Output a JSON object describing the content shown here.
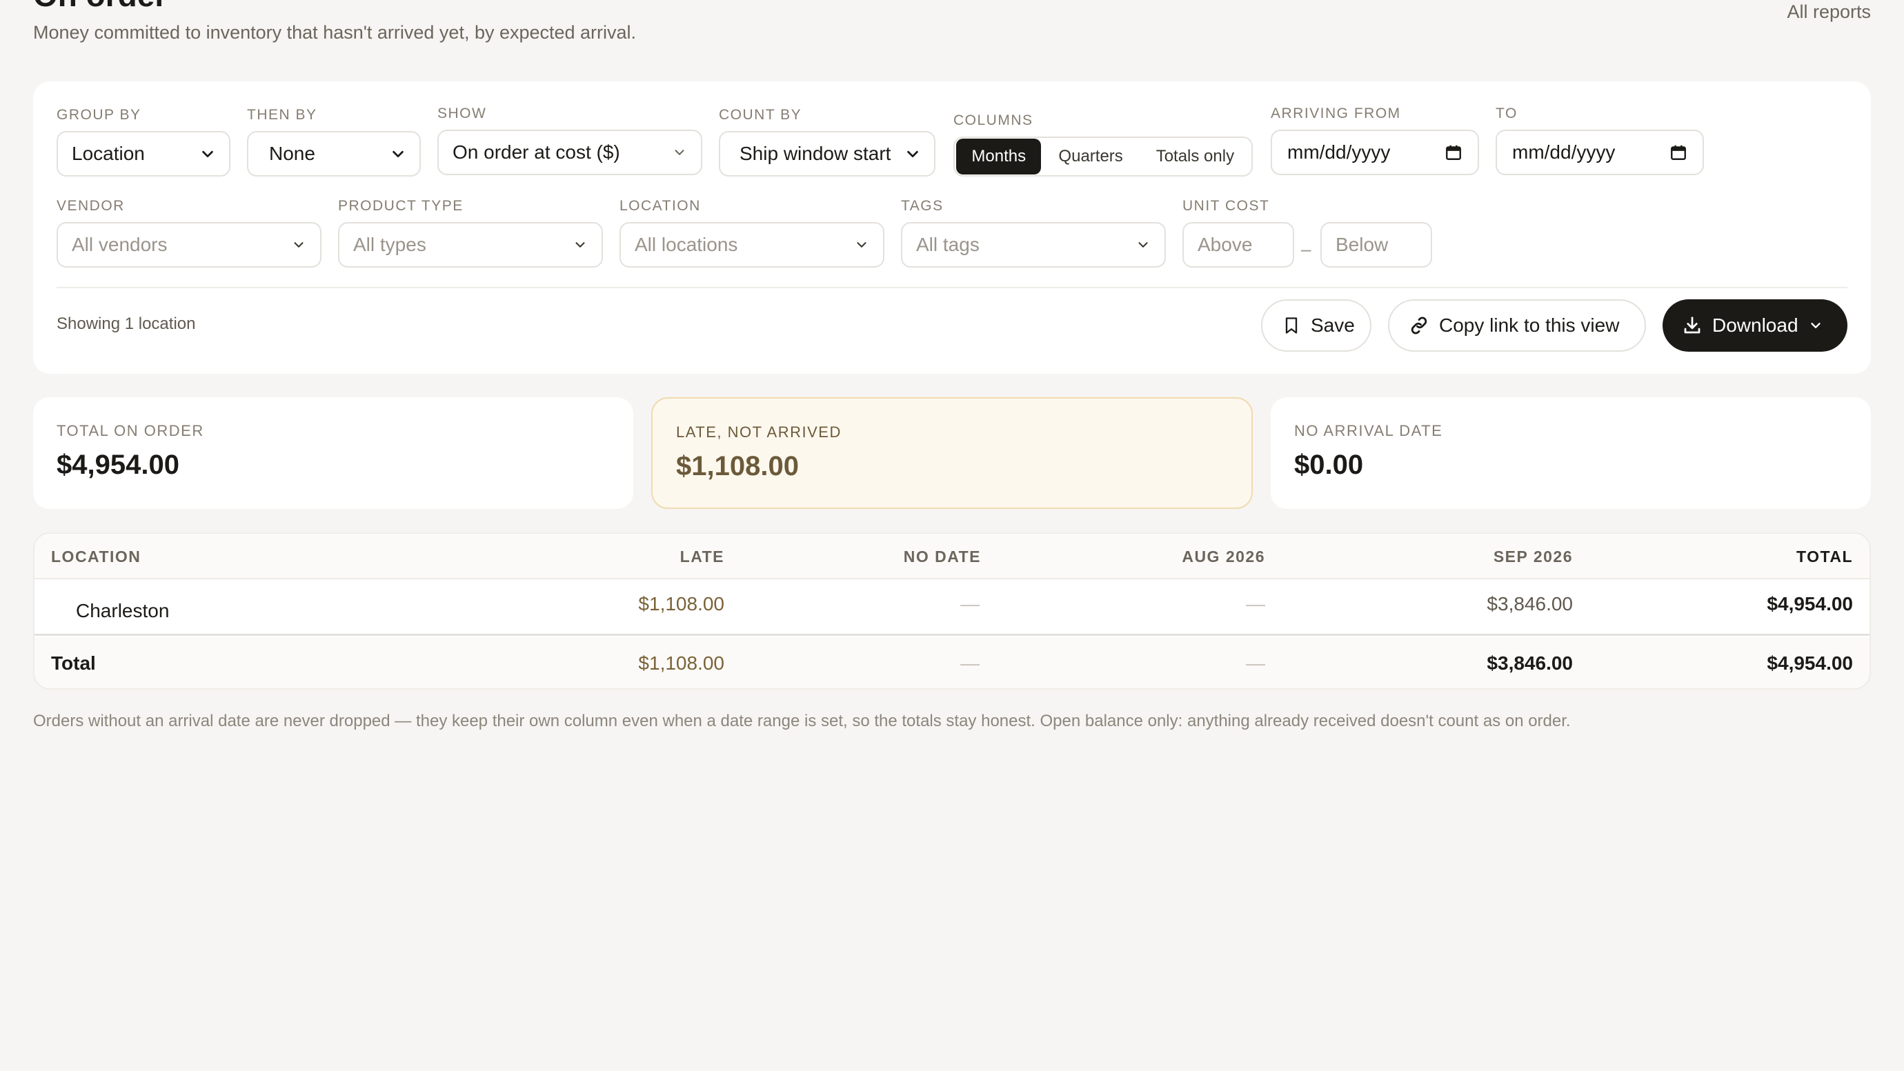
{
  "header": {
    "title": "On order",
    "subtitle": "Money committed to inventory that hasn't arrived yet, by expected arrival.",
    "all_reports": "All reports"
  },
  "filters": {
    "group_by": {
      "label": "GROUP BY",
      "value": "Location"
    },
    "then_by": {
      "label": "THEN BY",
      "value": "None"
    },
    "show": {
      "label": "SHOW",
      "value": "On order at cost ($)"
    },
    "count_by": {
      "label": "COUNT BY",
      "value": "Ship window start"
    },
    "columns": {
      "label": "COLUMNS",
      "options": [
        "Months",
        "Quarters",
        "Totals only"
      ],
      "selected": "Months"
    },
    "arriving_from": {
      "label": "ARRIVING FROM",
      "placeholder": "mm/dd/yyyy"
    },
    "to": {
      "label": "TO",
      "placeholder": "mm/dd/yyyy"
    },
    "vendor": {
      "label": "VENDOR",
      "value": "All vendors"
    },
    "product_type": {
      "label": "PRODUCT TYPE",
      "value": "All types"
    },
    "location": {
      "label": "LOCATION",
      "value": "All locations"
    },
    "tags": {
      "label": "TAGS",
      "value": "All tags"
    },
    "unit_cost": {
      "label": "UNIT COST",
      "above_placeholder": "Above",
      "below_placeholder": "Below",
      "separator": "–"
    }
  },
  "toolbar": {
    "showing": "Showing 1 location",
    "save_label": "Save",
    "copy_link_label": "Copy link to this view",
    "download_label": "Download"
  },
  "summary": {
    "total_on_order": {
      "label": "TOTAL ON ORDER",
      "value": "$4,954.00"
    },
    "late_not_arrived": {
      "label": "LATE, NOT ARRIVED",
      "value": "$1,108.00"
    },
    "no_arrival_date": {
      "label": "NO ARRIVAL DATE",
      "value": "$0.00"
    }
  },
  "table": {
    "columns": [
      "LOCATION",
      "LATE",
      "NO DATE",
      "AUG 2026",
      "SEP 2026",
      "TOTAL"
    ],
    "rows": [
      {
        "location": "Charleston",
        "late": "$1,108.00",
        "no_date": "—",
        "aug_2026": "—",
        "sep_2026": "$3,846.00",
        "total": "$4,954.00"
      }
    ],
    "total_row": {
      "label": "Total",
      "late": "$1,108.00",
      "no_date": "—",
      "aug_2026": "—",
      "sep_2026": "$3,846.00",
      "total": "$4,954.00"
    }
  },
  "footnote": "Orders without an arrival date are never dropped — they keep their own column even when a date range is set, so the totals stay honest. Open balance only: anything already received doesn't count as on order.",
  "colors": {
    "background": "#f6f5f3",
    "accent_dark": "#1c1a17",
    "late_text": "#7a6238",
    "late_card_bg": "#fdf8ee",
    "late_card_border": "#f0dbb0"
  }
}
